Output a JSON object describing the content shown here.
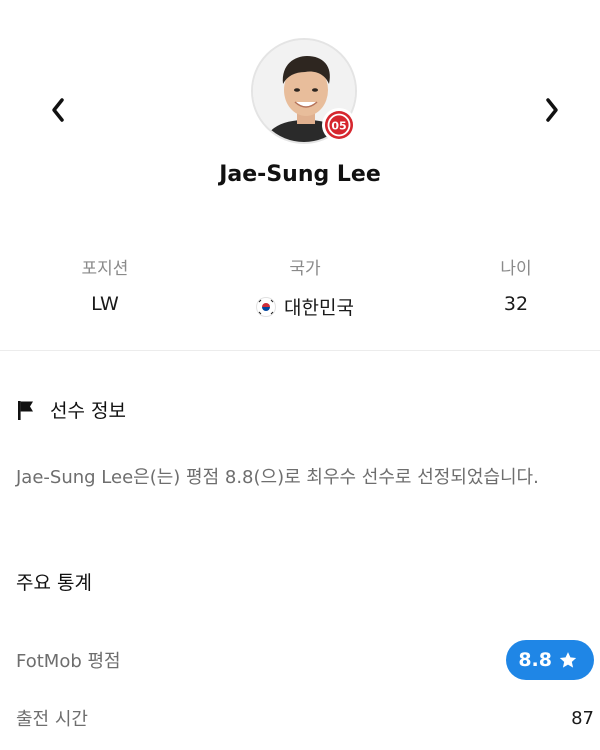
{
  "player": {
    "name": "Jae-Sung Lee",
    "club_badge_icon": "mainz-club-badge-icon"
  },
  "nav": {
    "prev_icon": "chevron-left-icon",
    "next_icon": "chevron-right-icon"
  },
  "info": {
    "position_label": "포지션",
    "position_value": "LW",
    "country_label": "국가",
    "country_value": "대한민국",
    "country_flag_icon": "south-korea-flag-icon",
    "age_label": "나이",
    "age_value": "32"
  },
  "player_info_section": {
    "icon": "flag-icon",
    "title": "선수 정보",
    "description": "Jae-Sung Lee은(는) 평점 8.8(으)로 최우수 선수로 선정되었습니다."
  },
  "key_stats": {
    "title": "주요 통계",
    "rows": [
      {
        "label": "FotMob 평점",
        "value": "8.8",
        "icon": "star-icon",
        "badge_color": "#1f86e6"
      },
      {
        "label": "출전 시간",
        "value": "87"
      }
    ]
  }
}
